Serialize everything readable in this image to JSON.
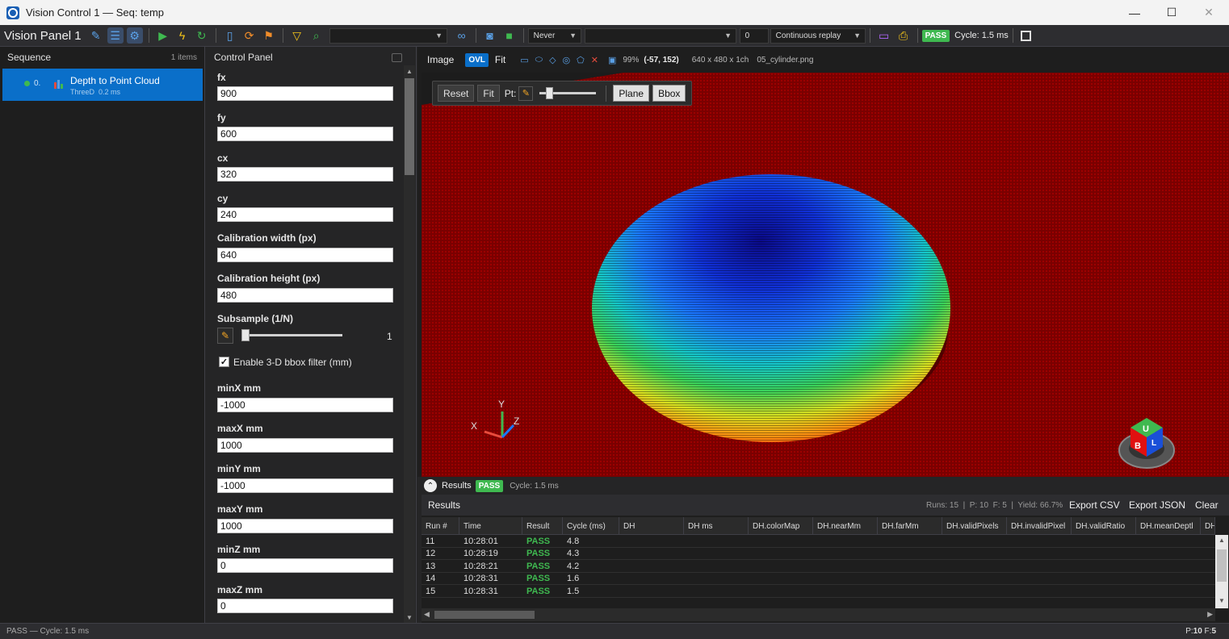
{
  "window": {
    "title": "Vision Control 1 — Seq: temp",
    "minimize": "—",
    "maximize": "☐",
    "close": "✕"
  },
  "toolbar": {
    "panel_name": "Vision Panel 1",
    "trigger_mode": "Never",
    "combo_value": "",
    "count_value": "0",
    "replay_mode": "Continuous replay",
    "pass_badge": "PASS",
    "cycle": "Cycle: 1.5 ms"
  },
  "sequence": {
    "title": "Sequence",
    "count": "1 items",
    "items": [
      {
        "index": "0.",
        "name": "Depth to Point Cloud",
        "category": "ThreeD",
        "time": "0.2 ms"
      }
    ]
  },
  "control_panel": {
    "title": "Control Panel",
    "fields": [
      {
        "label": "fx",
        "value": "900"
      },
      {
        "label": "fy",
        "value": "600"
      },
      {
        "label": "cx",
        "value": "320"
      },
      {
        "label": "cy",
        "value": "240"
      },
      {
        "label": "Calibration width (px)",
        "value": "640"
      },
      {
        "label": "Calibration height (px)",
        "value": "480"
      }
    ],
    "subsample": {
      "label": "Subsample (1/N)",
      "value": "1",
      "fraction": 0.0
    },
    "bbox_filter": {
      "label": "Enable 3-D bbox filter (mm)",
      "checked": true
    },
    "bbox_fields": [
      {
        "label": "minX mm",
        "value": "-1000"
      },
      {
        "label": "maxX mm",
        "value": "1000"
      },
      {
        "label": "minY mm",
        "value": "-1000"
      },
      {
        "label": "maxY mm",
        "value": "1000"
      },
      {
        "label": "minZ mm",
        "value": "0"
      },
      {
        "label": "maxZ mm",
        "value": "0"
      }
    ]
  },
  "image_panel": {
    "title": "Image",
    "ovl": "OVL",
    "fit": "Fit",
    "zoom": "99%",
    "cursor": "(-57, 152)",
    "dims": "640 x 480 x 1ch",
    "file": "05_cylinder.png",
    "float_toolbar": {
      "reset": "Reset",
      "fit": "Fit",
      "pt": "Pt:",
      "plane": "Plane",
      "bbox": "Bbox",
      "slider_fraction": 0.12
    },
    "axes": {
      "x": "X",
      "y": "Y",
      "z": "Z"
    },
    "cube": {
      "top": "U",
      "front": "B",
      "side": "L"
    }
  },
  "results": {
    "label": "Results",
    "badge": "PASS",
    "cycle": "Cycle: 1.5 ms",
    "title": "Results",
    "stats": "Runs: 15  |  P: 10  F: 5  |  Yield: 66.7%",
    "export_csv": "Export CSV",
    "export_json": "Export JSON",
    "clear": "Clear",
    "columns": [
      "Run #",
      "Time",
      "Result",
      "Cycle (ms)",
      "DH",
      "DH ms",
      "DH.colorMap",
      "DH.nearMm",
      "DH.farMm",
      "DH.validPixels",
      "DH.invalidPixel",
      "DH.validRatio",
      "DH.meanDeptl",
      "DH"
    ],
    "rows": [
      {
        "run": "11",
        "time": "10:28:01",
        "result": "PASS",
        "cycle": "4.8"
      },
      {
        "run": "12",
        "time": "10:28:19",
        "result": "PASS",
        "cycle": "4.3"
      },
      {
        "run": "13",
        "time": "10:28:21",
        "result": "PASS",
        "cycle": "4.2"
      },
      {
        "run": "14",
        "time": "10:28:31",
        "result": "PASS",
        "cycle": "1.6"
      },
      {
        "run": "15",
        "time": "10:28:31",
        "result": "PASS",
        "cycle": "1.5"
      }
    ]
  },
  "statusbar": {
    "left": "PASS — Cycle: 1.5 ms",
    "p_label": "P:",
    "p_value": "10",
    "f_label": "F:",
    "f_value": "5"
  },
  "colors": {
    "accent": "#0a6fc9",
    "pass": "#3fb950",
    "floor": "#7a0000"
  }
}
